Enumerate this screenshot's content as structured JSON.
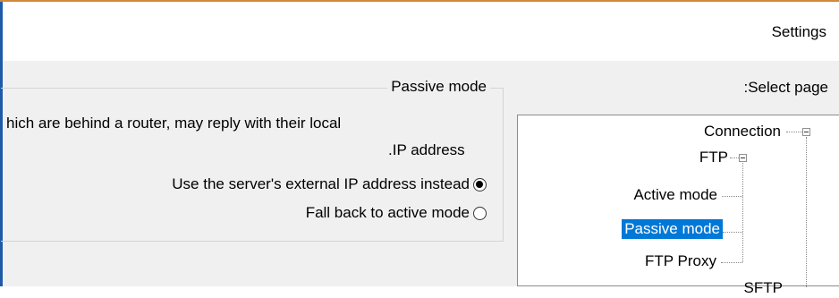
{
  "window": {
    "title": "Settings"
  },
  "passive_mode": {
    "group_title": "Passive mode",
    "description_line1": "hich are behind a router, may reply with their local",
    "description_line2": ".IP address",
    "option_external_ip": "Use the server's external IP address instead",
    "option_fallback_active": "Fall back to active mode",
    "selected_option": "option_external_ip"
  },
  "page_selector": {
    "label": ":Select page",
    "tree": [
      {
        "label": "Connection",
        "expanded": true
      },
      {
        "label": "FTP",
        "expanded": true
      },
      {
        "label": "Active mode"
      },
      {
        "label": "Passive mode",
        "selected": true
      },
      {
        "label": "FTP Proxy"
      },
      {
        "label": "SFTP"
      }
    ]
  },
  "colors": {
    "selection": "#0078d7",
    "window_accent": "#d08a3a",
    "frame_border": "#1e5aa8"
  }
}
